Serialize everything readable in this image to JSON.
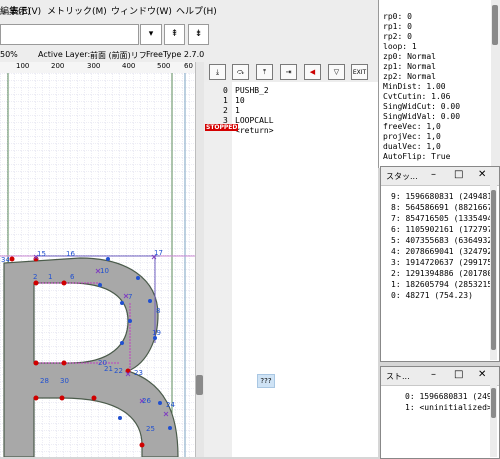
{
  "menu": {
    "items": [
      "編集(E)",
      "表示(V)",
      "メトリック(M)",
      "ウィンドウ(W)",
      "ヘルプ(H)"
    ]
  },
  "nav": {
    "prev": "⇞",
    "next": "⇟"
  },
  "status": {
    "zoom": "50%",
    "active_layer_label": "Active Layer:",
    "active_layer_value": "前面 (前面)リフ",
    "rasterizer": "FreeType 2.7.0"
  },
  "ruler": {
    "ticks": [
      "100",
      "200",
      "300",
      "400",
      "500",
      "60"
    ]
  },
  "toolbar": {
    "buttons": [
      "step-into",
      "step-over",
      "step-out",
      "continue",
      "watch",
      "stop",
      "exit"
    ],
    "exit_label": "EXIT"
  },
  "code": {
    "lines": [
      {
        "num": "0",
        "text": "PUSHB_2"
      },
      {
        "num": "1",
        "text": " 10"
      },
      {
        "num": "2",
        "text": " 1"
      },
      {
        "num": "3",
        "text": "LOOPCALL"
      },
      {
        "num": "",
        "text": "<return>"
      }
    ],
    "stopped_marker": "STOPPED",
    "unknown_button": "???"
  },
  "graphics_state": {
    "lines": [
      "rp0: 0",
      "rp1: 0",
      "rp2: 0",
      "loop: 1",
      "zp0: Normal",
      "zp1: Normal",
      "zp2: Normal",
      "MinDist: 1.00",
      "CvtCutin: 1.06",
      "SingWidCut: 0.00",
      "SingWidVal: 0.00",
      "freeVec: 1,0",
      "projVec: 1,0",
      "dualVec: 1,0",
      "AutoFlip: True"
    ]
  },
  "stack_window": {
    "title": "スタッ...",
    "rows": [
      "9: 1596680831 (249481",
      "8: 564586691 (8821667",
      "7: 854716505 (1335494",
      "6: 1105902161 (172797",
      "5: 407355683 (6364932",
      "4: 2078669041 (324792",
      "3: 1914720637 (299175",
      "2: 1291394886 (201780",
      "1: 182605794 (2853215",
      "0: 48271 (754.23)"
    ]
  },
  "stack_window2": {
    "title": "スト...",
    "rows": [
      "0: 1596680831 (249",
      "1: <uninitialized>"
    ]
  },
  "glyph": {
    "point_labels": [
      "34",
      "15",
      "16",
      "17",
      "2",
      "1",
      "6",
      "7",
      "8",
      "10",
      "19",
      "20",
      "21",
      "22",
      "23",
      "24",
      "25",
      "26",
      "28",
      "30"
    ]
  },
  "colors": {
    "glyph_fill": "#a8a8a8",
    "outline": "#7a6a50",
    "point_blue": "#2050d0",
    "point_red": "#d00000",
    "hint_magenta": "#c040c0"
  }
}
